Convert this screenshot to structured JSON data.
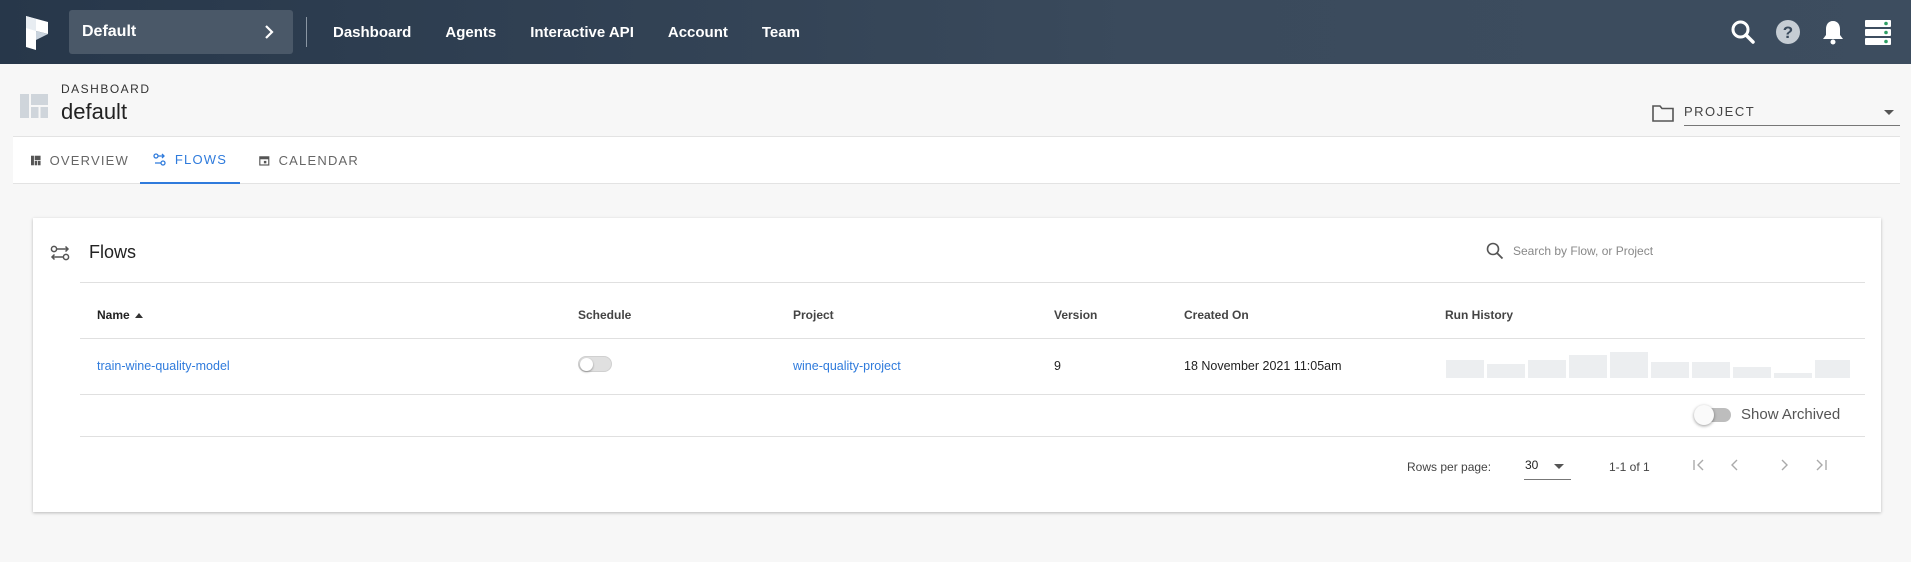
{
  "topbar": {
    "team": "Default",
    "nav": [
      "Dashboard",
      "Agents",
      "Interactive API",
      "Account",
      "Team"
    ],
    "icons": [
      "search-icon",
      "help-icon",
      "bell-icon",
      "server-icon"
    ]
  },
  "header": {
    "breadcrumb": "DASHBOARD",
    "title": "default",
    "project_label": "PROJECT"
  },
  "tabs": [
    {
      "label": "OVERVIEW",
      "icon": "overview-icon",
      "active": false
    },
    {
      "label": "FLOWS",
      "icon": "flows-icon",
      "active": true
    },
    {
      "label": "CALENDAR",
      "icon": "calendar-icon",
      "active": false
    }
  ],
  "flows": {
    "title": "Flows",
    "search_placeholder": "Search by Flow, or Project",
    "columns": [
      "Name",
      "Schedule",
      "Project",
      "Version",
      "Created On",
      "Run History"
    ],
    "sort_column": "Name",
    "rows": [
      {
        "name": "train-wine-quality-model",
        "schedule_on": false,
        "project": "wine-quality-project",
        "version": "9",
        "created_on": "18 November 2021 11:05am"
      }
    ],
    "show_archived_label": "Show Archived",
    "show_archived_on": false,
    "rows_per_page_label": "Rows per page:",
    "rows_per_page": "30",
    "range": "1-1 of 1"
  },
  "colors": {
    "accent": "#2f7bdc",
    "topbar": "#27374a",
    "run_history_bar": "#eceef0"
  }
}
